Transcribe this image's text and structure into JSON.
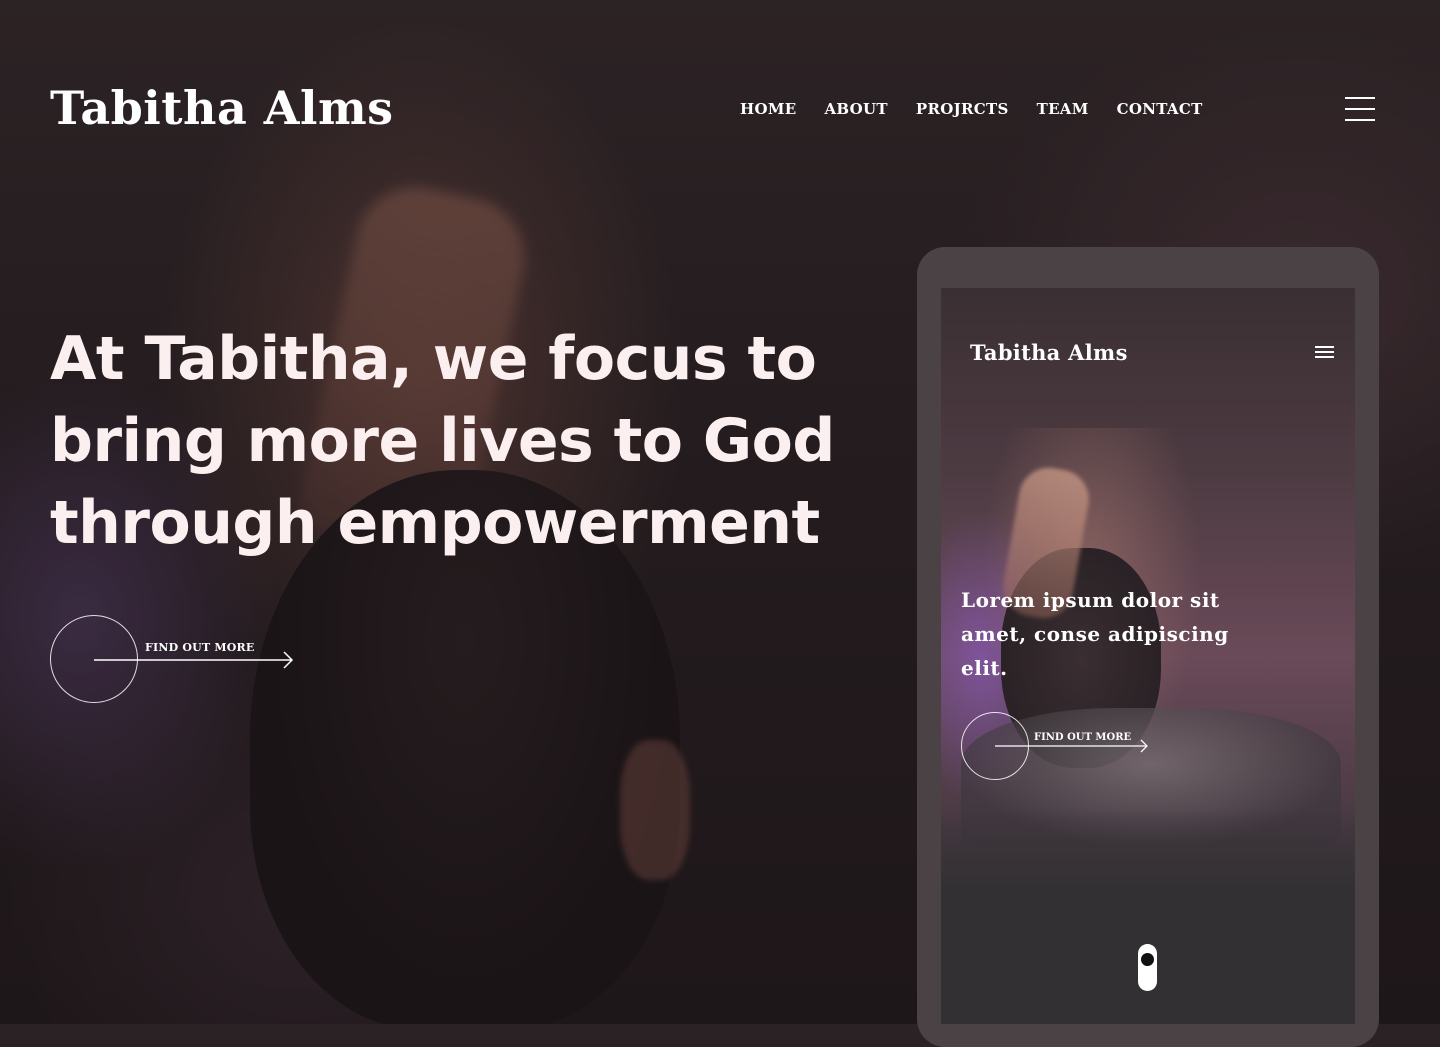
{
  "site": {
    "logo": "Tabitha Alms"
  },
  "nav": {
    "items": [
      {
        "label": "HOME"
      },
      {
        "label": "ABOUT"
      },
      {
        "label": "PROJRCTS"
      },
      {
        "label": "TEAM"
      },
      {
        "label": "CONTACT"
      }
    ],
    "menu_icon": "hamburger-icon"
  },
  "hero": {
    "headline": "At Tabitha, we focus to bring more lives to God through empowerment",
    "cta_label": "FIND OUT MORE",
    "cta_icon": "arrow-right-icon"
  },
  "mobile_preview": {
    "logo": "Tabitha Alms",
    "menu_icon": "hamburger-icon",
    "heading": "Lorem ipsum dolor sit amet, conse adipiscing elit.",
    "cta_label": "FIND OUT MORE",
    "cta_icon": "arrow-right-icon",
    "scroll_icon": "mouse-scroll-icon"
  },
  "colors": {
    "background": "#2a2224",
    "text": "#ffffff",
    "headline": "#fbeff0",
    "device_frame": "#4a4244"
  }
}
